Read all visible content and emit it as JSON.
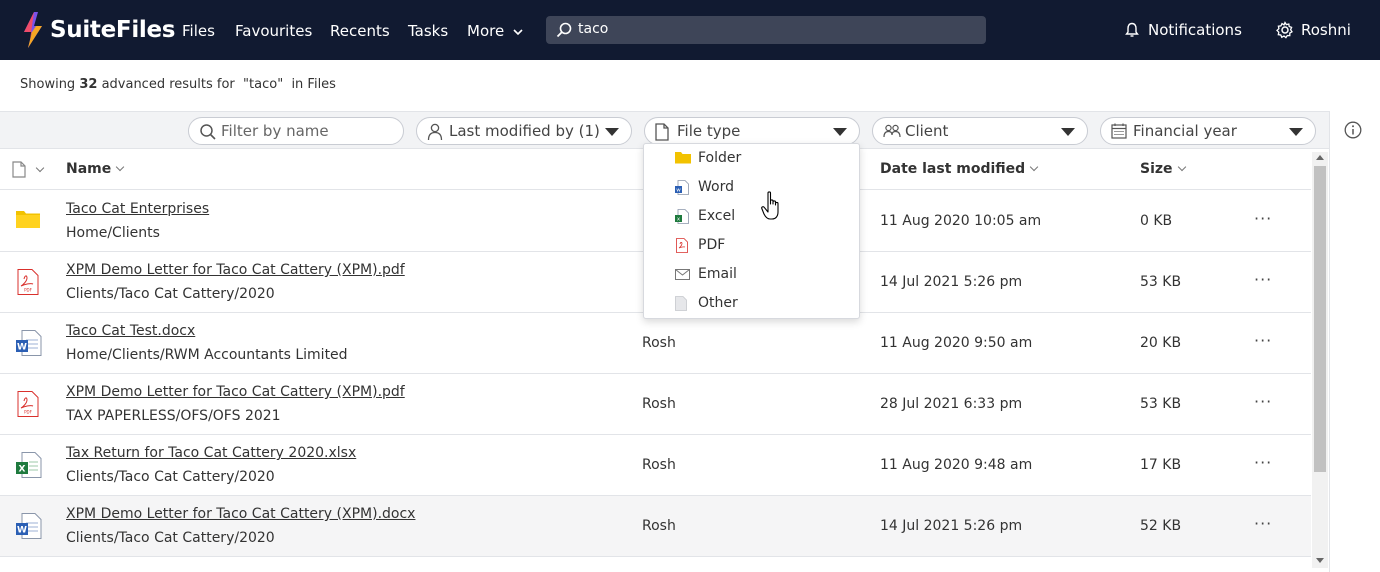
{
  "app": {
    "name": "SuiteFiles",
    "nav": [
      "Files",
      "Favourites",
      "Recents",
      "Tasks"
    ],
    "more_label": "More",
    "search_value": "taco",
    "notifications_label": "Notifications",
    "user_name": "Roshni"
  },
  "summary": {
    "prefix": "Showing",
    "count": "32",
    "middle": "advanced results for",
    "query": "\"taco\"",
    "suffix": "in Files"
  },
  "filters": {
    "name_placeholder": "Filter by name",
    "modified_by": "Last modified by (1)",
    "file_type": "File type",
    "client": "Client",
    "financial_year": "Financial year"
  },
  "columns": {
    "name": "Name",
    "date": "Date last modified",
    "size": "Size"
  },
  "rows": [
    {
      "name": "Taco Cat Enterprises",
      "path": "Home/Clients",
      "modified_by": "",
      "date": "11 Aug 2020 10:05 am",
      "size": "0 KB",
      "type": "folder"
    },
    {
      "name": "XPM Demo Letter for Taco Cat Cattery (XPM).pdf",
      "path": "Clients/Taco Cat Cattery/2020",
      "modified_by": "",
      "date": "14 Jul 2021 5:26 pm",
      "size": "53 KB",
      "type": "pdf"
    },
    {
      "name": "Taco Cat Test.docx",
      "path": "Home/Clients/RWM Accountants Limited",
      "modified_by": "Rosh",
      "date": "11 Aug 2020 9:50 am",
      "size": "20 KB",
      "type": "word"
    },
    {
      "name": "XPM Demo Letter for Taco Cat Cattery (XPM).pdf",
      "path": "TAX PAPERLESS/OFS/OFS 2021",
      "modified_by": "Rosh",
      "date": "28 Jul 2021 6:33 pm",
      "size": "53 KB",
      "type": "pdf"
    },
    {
      "name": "Tax Return for Taco Cat Cattery 2020.xlsx",
      "path": "Clients/Taco Cat Cattery/2020",
      "modified_by": "Rosh",
      "date": "11 Aug 2020 9:48 am",
      "size": "17 KB",
      "type": "excel"
    },
    {
      "name": "XPM Demo Letter for Taco Cat Cattery (XPM).docx",
      "path": "Clients/Taco Cat Cattery/2020",
      "modified_by": "Rosh",
      "date": "14 Jul 2021 5:26 pm",
      "size": "52 KB",
      "type": "word"
    }
  ],
  "row_menu": "···",
  "file_type_options": [
    "Folder",
    "Word",
    "Excel",
    "PDF",
    "Email",
    "Other"
  ],
  "colors": {
    "topbar": "#111a31",
    "folder": "#f2c200",
    "pdf": "#d9302c",
    "word": "#2b5fb4",
    "excel": "#1e7a3e"
  }
}
